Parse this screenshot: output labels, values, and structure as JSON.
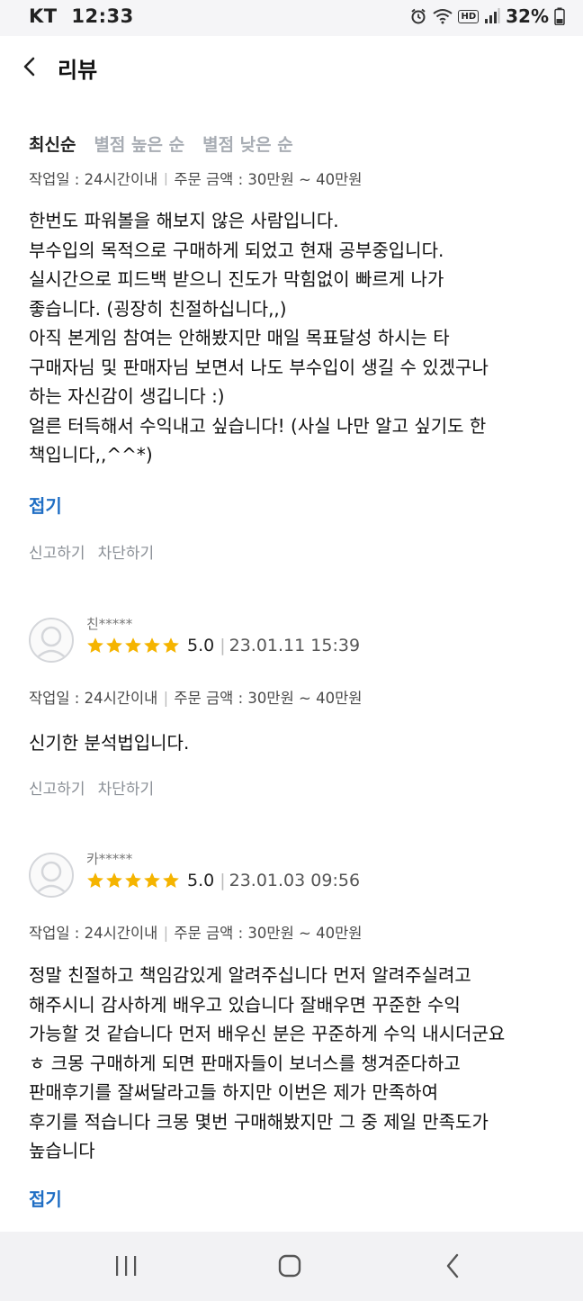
{
  "status": {
    "carrier": "KT",
    "time": "12:33",
    "battery": "32%",
    "icons": [
      "alarm-icon",
      "wifi-icon",
      "hd-icon",
      "signal-icon",
      "battery-icon"
    ],
    "hd_label": "HD"
  },
  "header": {
    "title": "리뷰",
    "back_icon": "chevron-left-icon"
  },
  "sort": {
    "tabs": [
      "최신순",
      "별점 높은 순",
      "별점 낮은 순"
    ],
    "active": 0
  },
  "labels": {
    "work_day_key": "작업일",
    "order_amount_key": "주문 금액",
    "fold": "접기",
    "report": "신고하기",
    "block": "차단하기"
  },
  "reviews": [
    {
      "work_day": "24시간이내",
      "order_amount": "30만원 ~ 40만원",
      "body_lines": [
        "한번도 파워볼을 해보지 않은 사람입니다.",
        "부수입의 목적으로 구매하게 되었고 현재 공부중입니다.",
        "실시간으로 피드백 받으니 진도가 막힘없이 빠르게 나가",
        "좋습니다. (굉장히 친절하십니다,,)",
        "아직 본게임 참여는 안해봤지만 매일 목표달성 하시는 타",
        "구매자님 및 판매자님 보면서 나도 부수입이 생길 수 있겠구나",
        "하는 자신감이 생깁니다 :)",
        "얼른 터득해서 수익내고 싶습니다! (사실 나만 알고 싶기도 한",
        "책입니다,,^^*)"
      ]
    },
    {
      "name": "친*****",
      "rating": 5,
      "score": "5.0",
      "date": "23.01.11 15:39",
      "work_day": "24시간이내",
      "order_amount": "30만원 ~ 40만원",
      "body_lines": [
        "신기한 분석법입니다."
      ]
    },
    {
      "name": "카*****",
      "rating": 5,
      "score": "5.0",
      "date": "23.01.03 09:56",
      "work_day": "24시간이내",
      "order_amount": "30만원 ~ 40만원",
      "body_lines": [
        "정말 친절하고 책임감있게 알려주십니다 먼저 알려주실려고",
        "해주시니 감사하게 배우고 있습니다 잘배우면 꾸준한 수익",
        "가능할 것 같습니다 먼저 배우신 분은 꾸준하게 수익 내시더군요",
        "ㅎ 크몽 구매하게 되면 판매자들이 보너스를 챙겨준다하고",
        "판매후기를 잘써달라고들 하지만 이번은 제가 만족하여",
        "후기를 적습니다 크몽  몇번 구매해봤지만 그 중 제일 만족도가",
        "높습니다"
      ]
    }
  ],
  "nav": {
    "icons": [
      "recent-apps-icon",
      "home-icon",
      "back-icon"
    ]
  },
  "colors": {
    "link": "#1f6ec4",
    "star": "#f5b400",
    "muted": "#8a8f96",
    "tab_inactive": "#a8adb4"
  }
}
